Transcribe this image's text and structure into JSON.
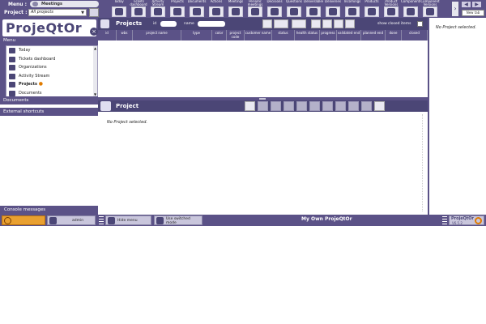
{
  "topbar": {
    "menu_label": "Menu :",
    "menu_value": "Meetings",
    "project_label": "Project :",
    "project_value": "All projects",
    "items": [
      {
        "label": "Today",
        "icon": "today-icon"
      },
      {
        "label": "Tickets dashboard",
        "icon": "tickets-dashboard-icon"
      },
      {
        "label": "Activity Stream",
        "icon": "activity-stream-icon"
      },
      {
        "label": "Projects",
        "icon": "projects-icon"
      },
      {
        "label": "Documents",
        "icon": "documents-icon"
      },
      {
        "label": "Actions",
        "icon": "actions-icon"
      },
      {
        "label": "Meetings",
        "icon": "meetings-icon"
      },
      {
        "label": "Periodic meetings",
        "icon": "periodic-meetings-icon"
      },
      {
        "label": "Decisions",
        "icon": "decisions-icon"
      },
      {
        "label": "Questions",
        "icon": "questions-icon"
      },
      {
        "label": "Deliverables",
        "icon": "deliverables-icon"
      },
      {
        "label": "Deliveries",
        "icon": "deliveries-icon"
      },
      {
        "label": "Incomings",
        "icon": "incomings-icon"
      },
      {
        "label": "Products",
        "icon": "products-icon"
      },
      {
        "label": "Product Versions",
        "icon": "product-versions-icon"
      },
      {
        "label": "Components",
        "icon": "components-icon"
      },
      {
        "label": "Component Versions",
        "icon": "component-versions-icon"
      }
    ],
    "new_tab": "New tab"
  },
  "logo": {
    "text": "ProjeQtOr"
  },
  "left": {
    "menu_title": "Menu",
    "menu_items": [
      {
        "label": "Today"
      },
      {
        "label": "Tickets dashboard"
      },
      {
        "label": "Organizations"
      },
      {
        "label": "Activity Stream"
      },
      {
        "label": "Projects",
        "selected": true
      },
      {
        "label": "Documents"
      }
    ],
    "documents_title": "Documents",
    "shortcuts_title": "External shortcuts",
    "console_title": "Console messages"
  },
  "list": {
    "title": "Projects",
    "id_label": "id",
    "name_label": "name",
    "show_closed_label": "show closed items",
    "columns": [
      "id",
      "wbs",
      "project name",
      "type",
      "color",
      "project code",
      "customer name",
      "status",
      "health status",
      "progress",
      "validated end",
      "planned end",
      "done",
      "closed"
    ]
  },
  "detail": {
    "title": "Project",
    "empty_text": "No Project selected."
  },
  "right": {
    "empty_text": "No Project selected."
  },
  "statusbar": {
    "user": "admin",
    "hide_menu": "Hide menu",
    "switched_mode": "Use switched mode",
    "center_text": "My Own ProjeQtOr",
    "app_name": "ProjeQtOr",
    "version": "V6.5.2"
  },
  "colors": {
    "header_bg": "#5b5287",
    "dark_header": "#4b4676",
    "accent": "#e07b00"
  }
}
